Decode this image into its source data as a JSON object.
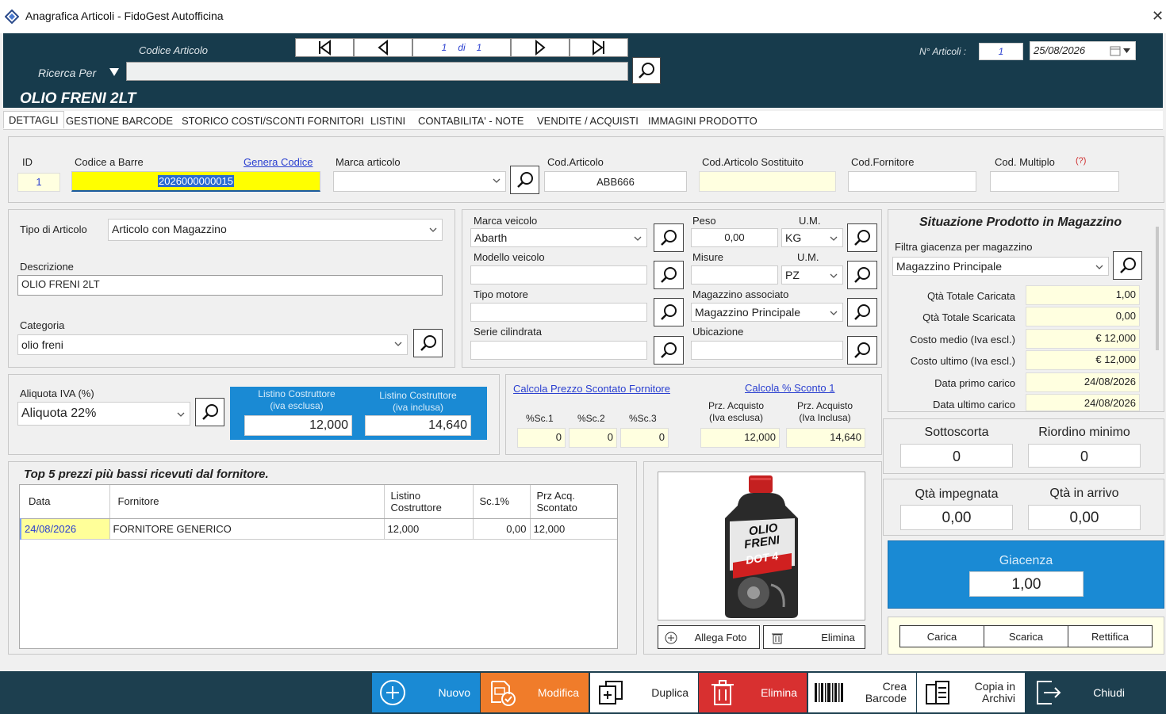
{
  "window": {
    "title": "Anagrafica Articoli - FidoGest Autofficina",
    "close_icon": "close-icon"
  },
  "header": {
    "codice_label": "Codice Articolo",
    "ricerca_label": "Ricerca Per",
    "nav_counter": {
      "current": "1",
      "di": "di",
      "total": "1"
    },
    "n_articoli_label": "N° Articoli :",
    "n_articoli_value": "1",
    "date": "25/08/2026",
    "product_title": "OLIO FRENI 2LT",
    "search_value": ""
  },
  "tabs": [
    "DETTAGLI",
    "GESTIONE BARCODE",
    "STORICO COSTI/SCONTI FORNITORI",
    "LISTINI",
    "CONTABILITA' - NOTE",
    "VENDITE / ACQUISTI",
    "IMMAGINI PRODOTTO"
  ],
  "ident": {
    "id_label": "ID",
    "id_value": "1",
    "barcode_label": "Codice a Barre",
    "barcode_value": "2026000000015",
    "genera_link": "Genera Codice",
    "marca_label": "Marca articolo",
    "marca_value": "",
    "cod_articolo_label": "Cod.Articolo",
    "cod_articolo_value": "ABB666",
    "cod_sost_label": "Cod.Articolo Sostituito",
    "cod_sost_value": "",
    "cod_forn_label": "Cod.Fornitore",
    "cod_forn_value": "",
    "cod_mult_label": "Cod. Multiplo",
    "cod_mult_hint": "(?)",
    "cod_mult_value": ""
  },
  "articolo": {
    "tipo_label": "Tipo di Articolo",
    "tipo_value": "Articolo con Magazzino",
    "descr_label": "Descrizione",
    "descr_value": "OLIO FRENI 2LT",
    "cat_label": "Categoria",
    "cat_value": "olio freni"
  },
  "veicolo": {
    "marca_label": "Marca veicolo",
    "marca_value": "Abarth",
    "modello_label": "Modello veicolo",
    "modello_value": "",
    "motore_label": "Tipo motore",
    "motore_value": "",
    "cilindrata_label": "Serie cilindrata",
    "cilindrata_value": "",
    "peso_label": "Peso",
    "peso_value": "0,00",
    "um_label": "U.M.",
    "um_peso": "KG",
    "misure_label": "Misure",
    "misure_value": "",
    "um_misure": "PZ",
    "magazzino_label": "Magazzino associato",
    "magazzino_value": "Magazzino Principale",
    "ubicazione_label": "Ubicazione",
    "ubicazione_value": ""
  },
  "iva": {
    "label": "Aliquota IVA (%)",
    "value": "Aliquota 22%",
    "listino_excl_label1": "Listino Costruttore",
    "listino_excl_label2": "(iva esclusa)",
    "listino_excl_value": "12,000",
    "listino_incl_label1": "Listino Costruttore",
    "listino_incl_label2": "(iva inclusa)",
    "listino_incl_value": "14,640"
  },
  "sconti": {
    "calc_prezzo_link": "Calcola Prezzo Scontato Fornitore",
    "calc_sconto_link": "Calcola % Sconto 1",
    "sc1_label": "%Sc.1",
    "sc1": "0",
    "sc2_label": "%Sc.2",
    "sc2": "0",
    "sc3_label": "%Sc.3",
    "sc3": "0",
    "acq_excl_label1": "Prz. Acquisto",
    "acq_excl_label2": "(Iva esclusa)",
    "acq_excl": "12,000",
    "acq_incl_label1": "Prz. Acquisto",
    "acq_incl_label2": "(Iva Inclusa)",
    "acq_incl": "14,640"
  },
  "top5": {
    "title": "Top 5 prezzi più bassi ricevuti dal fornitore.",
    "headers": [
      "Data",
      "Fornitore",
      "Listino Costruttore",
      "Sc.1%",
      "Prz Acq. Scontato"
    ],
    "rows": [
      [
        "24/08/2026",
        "FORNITORE GENERICO",
        "12,000",
        "0,00",
        "12,000"
      ]
    ]
  },
  "foto": {
    "allega_label": "Allega Foto",
    "elimina_label": "Elimina",
    "image_text1": "OLIO",
    "image_text2": "FRENI",
    "image_text3": "DOT 4"
  },
  "situazione": {
    "title": "Situazione Prodotto in Magazzino",
    "filtra_label": "Filtra giacenza per magazzino",
    "filtra_value": "Magazzino Principale",
    "rows": [
      {
        "label": "Qtà Totale Caricata",
        "value": "1,00"
      },
      {
        "label": "Qtà Totale Scaricata",
        "value": "0,00"
      },
      {
        "label": "Costo medio (Iva escl.)",
        "value": "€ 12,000"
      },
      {
        "label": "Costo ultimo (Iva escl.)",
        "value": "€ 12,000"
      },
      {
        "label": "Data primo carico",
        "value": "24/08/2026"
      },
      {
        "label": "Data ultimo carico",
        "value": "24/08/2026"
      }
    ],
    "sottoscorta_label": "Sottoscorta",
    "sottoscorta": "0",
    "riordino_label": "Riordino minimo",
    "riordino": "0",
    "impegnata_label": "Qtà impegnata",
    "impegnata": "0,00",
    "arrivo_label": "Qtà in arrivo",
    "arrivo": "0,00",
    "giacenza_label": "Giacenza",
    "giacenza": "1,00",
    "carica": "Carica",
    "scarica": "Scarica",
    "rettifica": "Rettifica"
  },
  "toolbar": {
    "nuovo": "Nuovo",
    "modifica": "Modifica",
    "duplica": "Duplica",
    "elimina": "Elimina",
    "barcode1": "Crea",
    "barcode2": "Barcode",
    "copia1": "Copia in",
    "copia2": "Archivi",
    "chiudi": "Chiudi"
  },
  "colors": {
    "header": "#173b4c",
    "accent_blue": "#1a8ad4",
    "modifica": "#f07c2a",
    "elimina": "#d83030",
    "yellow": "#ffff00"
  }
}
